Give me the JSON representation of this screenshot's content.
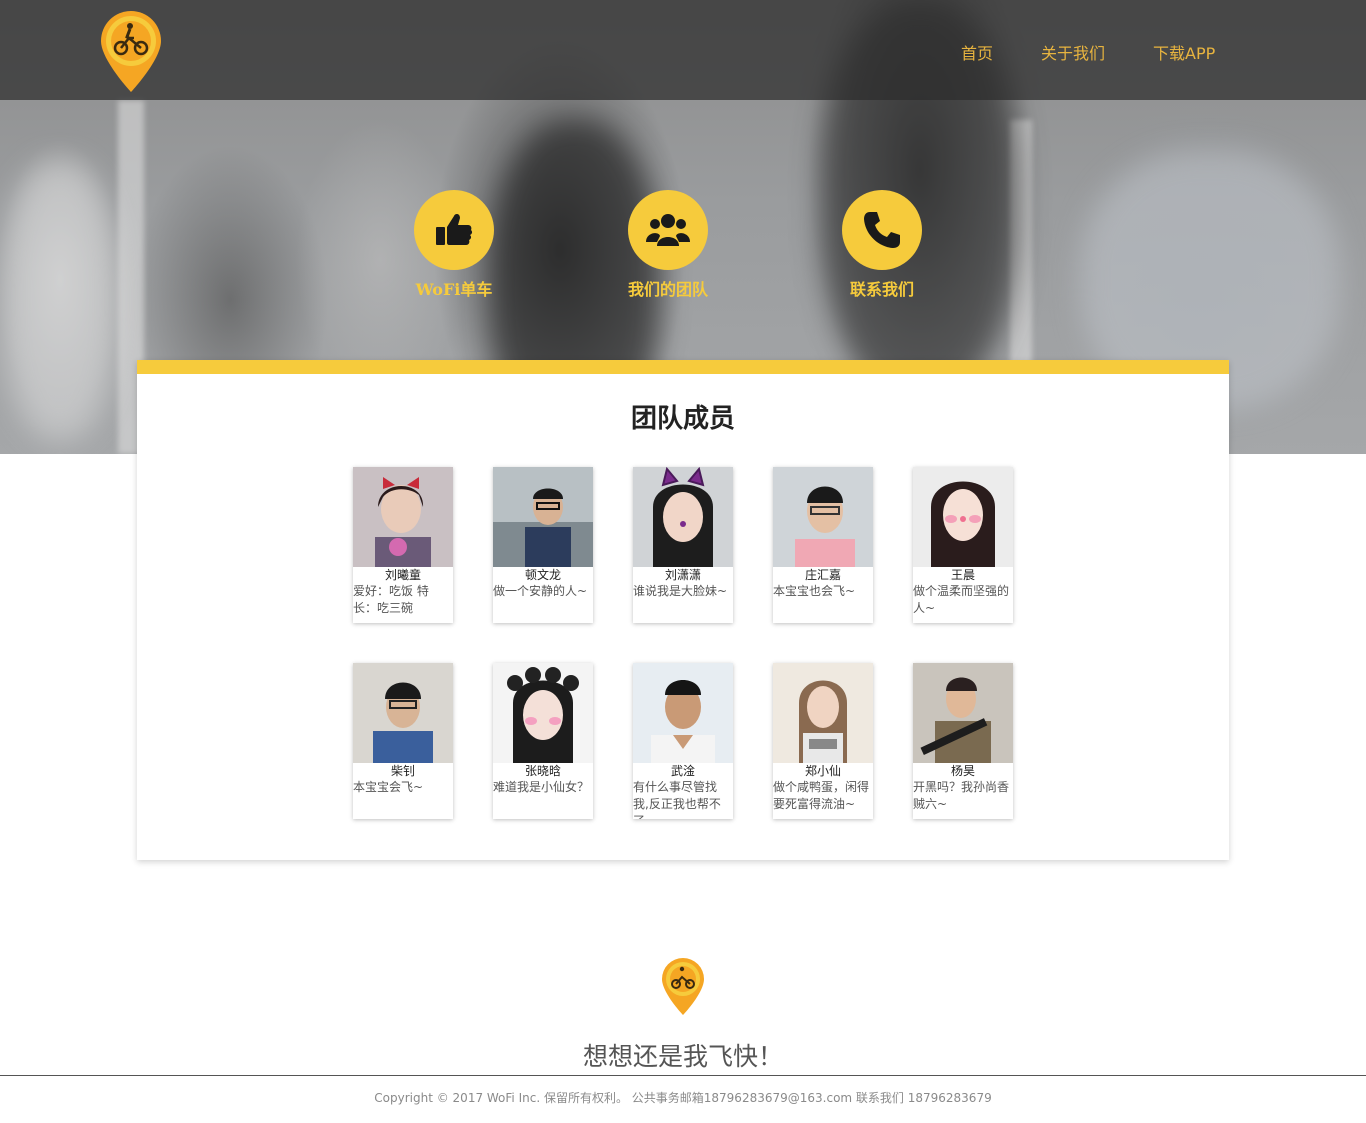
{
  "nav": {
    "items": [
      {
        "label": "首页"
      },
      {
        "label": "关于我们"
      },
      {
        "label": "下载APP"
      }
    ]
  },
  "features": [
    {
      "label": "WoFi单车",
      "icon": "thumbs-up-icon"
    },
    {
      "label": "我们的团队",
      "icon": "group-icon"
    },
    {
      "label": "联系我们",
      "icon": "phone-icon"
    }
  ],
  "team": {
    "title": "团队成员",
    "members": [
      {
        "name": "刘曦童",
        "motto": "爱好：吃饭 特长：吃三碗"
      },
      {
        "name": "顿文龙",
        "motto": "做一个安静的人~"
      },
      {
        "name": "刘潇潇",
        "motto": "谁说我是大脸妹~"
      },
      {
        "name": "庄汇嘉",
        "motto": "本宝宝也会飞~"
      },
      {
        "name": "王晨",
        "motto": "做个温柔而坚强的人~"
      },
      {
        "name": "柴钊",
        "motto": "本宝宝会飞~"
      },
      {
        "name": "张晓晗",
        "motto": "难道我是小仙女？"
      },
      {
        "name": "武淦",
        "motto": "有什么事尽管找我,反正我也帮不了~"
      },
      {
        "name": "郑小仙",
        "motto": "做个咸鸭蛋，闲得要死富得流油~"
      },
      {
        "name": "杨昊",
        "motto": "开黑吗？我孙尚香贼六~"
      }
    ]
  },
  "footer": {
    "slogan": "想想还是我飞快！",
    "copyright": "Copyright © 2017 WoFi Inc. 保留所有权利。 公共事务邮箱18796283679@163.com 联系我们 18796283679"
  },
  "colors": {
    "accent": "#f6cb3c",
    "nav_text": "#e8b43f",
    "logo_orange": "#f5a623"
  }
}
